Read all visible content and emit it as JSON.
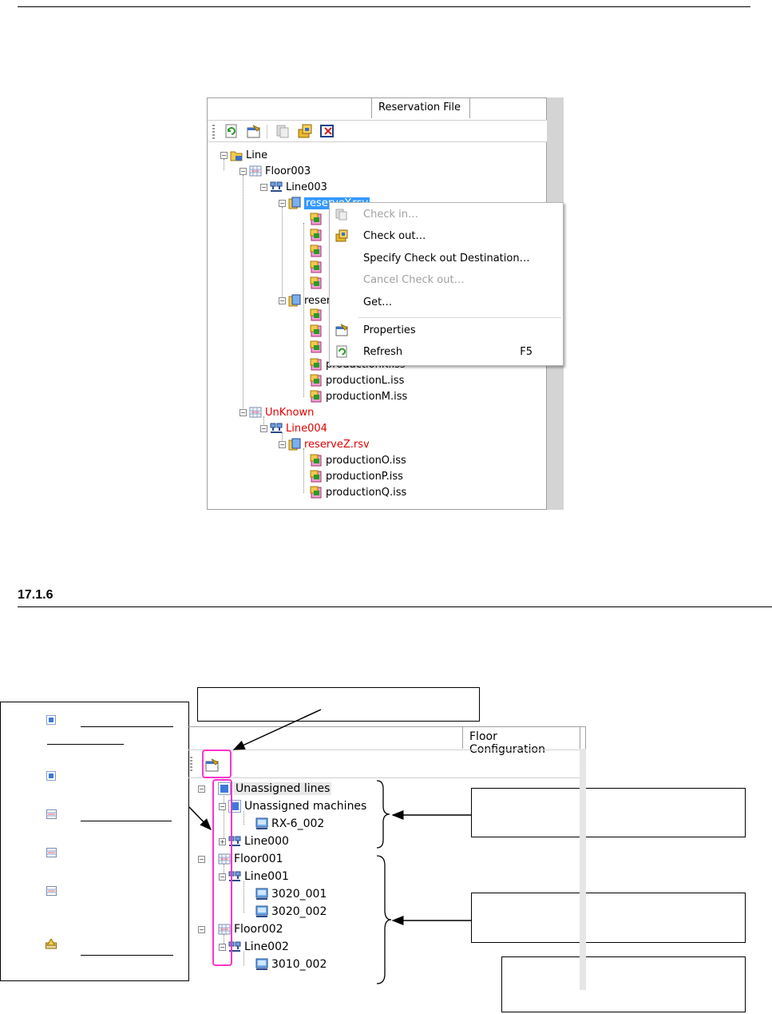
{
  "section_number": "17.1.6",
  "reservation_panel": {
    "tab_label": "Reservation File",
    "tree": {
      "root": "Line",
      "floor": "Floor003",
      "line": "Line003",
      "reserve1": "reserveY.rsv",
      "reserve2": "reserveX.rsv",
      "file_k": "productionK.iss",
      "file_l": "productionL.iss",
      "file_m": "productionM.iss",
      "unknown": "UnKnown",
      "line004": "Line004",
      "reserve_z": "reserveZ.rsv",
      "file_o": "productionO.iss",
      "file_p": "productionP.iss",
      "file_q": "productionQ.iss"
    },
    "context_menu": {
      "check_in": "Check in…",
      "check_out": "Check out…",
      "specify_dest": "Specify Check out Destination…",
      "cancel_check_out": "Cancel Check out…",
      "get": "Get…",
      "properties": "Properties",
      "refresh": "Refresh",
      "refresh_shortcut": "F5"
    }
  },
  "floor_panel": {
    "tab_label": "Floor Configuration",
    "tree": {
      "unassigned_lines": "Unassigned lines",
      "unassigned_machines": "Unassigned machines",
      "rx6": "RX-6_002",
      "line000": "Line000",
      "floor001": "Floor001",
      "line001": "Line001",
      "m3020_001": "3020_001",
      "m3020_002": "3020_002",
      "floor002": "Floor002",
      "line002": "Line002",
      "m3010_002": "3010_002"
    }
  },
  "colors": {
    "highlight": "#ff33cc",
    "selection": "#3399ff",
    "unknown_text": "#e00000"
  }
}
